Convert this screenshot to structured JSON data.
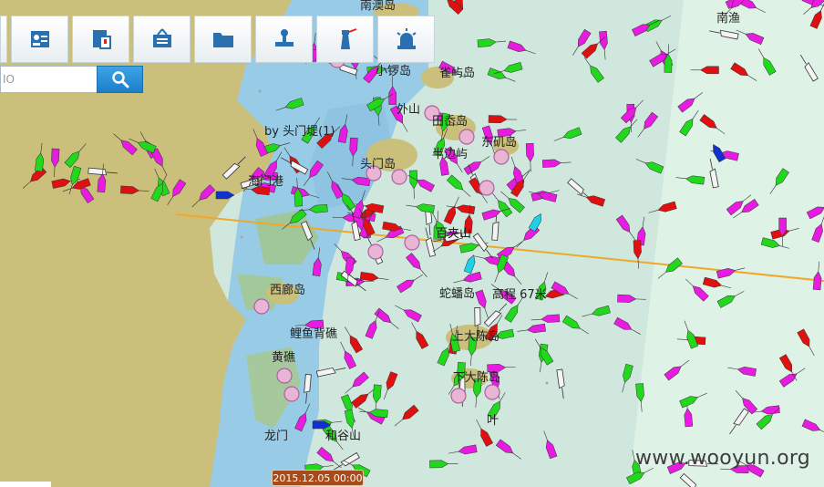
{
  "toolbar": {
    "buttons": [
      {
        "name": "partial-button",
        "icon": "blank"
      },
      {
        "name": "ship-certificate-button",
        "icon": "id-card-icon"
      },
      {
        "name": "document-alert-button",
        "icon": "document-alert-icon"
      },
      {
        "name": "notice-board-button",
        "icon": "notice-board-icon"
      },
      {
        "name": "folder-button",
        "icon": "folder-icon"
      },
      {
        "name": "stamp-button",
        "icon": "stamp-icon"
      },
      {
        "name": "lighthouse-button",
        "icon": "lighthouse-icon"
      },
      {
        "name": "alarm-button",
        "icon": "alarm-light-icon"
      }
    ]
  },
  "search": {
    "value": "IO",
    "icon": "search-icon"
  },
  "timestamp": "2015.12.05 00:00",
  "watermark": "www.wooyun.org",
  "colors": {
    "land": "#c9bf79",
    "shallow": "#95c8e6",
    "sea": "#c9e6da",
    "deep": "#def2e6",
    "route": "#f0a82a",
    "ship_magenta": "#e81be0",
    "ship_green": "#22d81d",
    "ship_red": "#e01010",
    "ship_blue": "#1030d0",
    "ship_cyan": "#20d0e8"
  },
  "labels": [
    {
      "text": "南澳岛"
    },
    {
      "text": "南渔"
    },
    {
      "text": "小锣岛"
    },
    {
      "text": "雀屿岛"
    },
    {
      "text": "by 头门堤(1)"
    },
    {
      "text": "外山"
    },
    {
      "text": "田岙岛"
    },
    {
      "text": "东矶岛"
    },
    {
      "text": "头门岛"
    },
    {
      "text": "半边屿"
    },
    {
      "text": "海门港"
    },
    {
      "text": "百夹山"
    },
    {
      "text": "西廊岛"
    },
    {
      "text": "蛇蟠岛"
    },
    {
      "text": "高程 67米"
    },
    {
      "text": "鲤鱼背礁"
    },
    {
      "text": "上大陈岛"
    },
    {
      "text": "下大陈岛"
    },
    {
      "text": "黄礁"
    },
    {
      "text": "龙门"
    },
    {
      "text": "和谷山"
    },
    {
      "text": "叶"
    }
  ]
}
